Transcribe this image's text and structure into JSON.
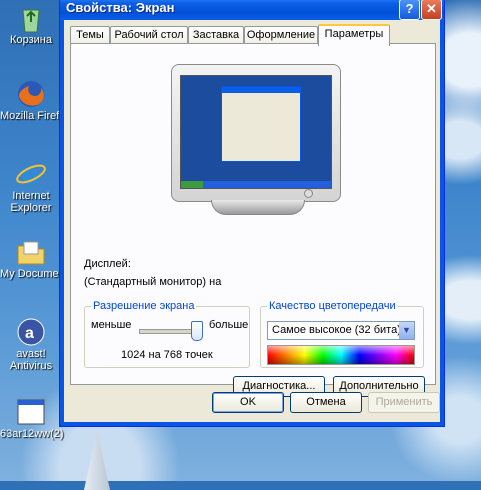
{
  "desktop": {
    "icons": [
      {
        "label": "Корзина"
      },
      {
        "label": "Mozilla Firefo"
      },
      {
        "label": "Internet",
        "label2": "Explorer"
      },
      {
        "label": "My Document"
      },
      {
        "label": "avast!",
        "label2": "Antivirus"
      },
      {
        "label": "63ar12ww(2)"
      }
    ]
  },
  "window": {
    "title": "Свойства: Экран",
    "help_glyph": "?",
    "close_glyph": "✕",
    "tabs": [
      {
        "label": "Темы"
      },
      {
        "label": "Рабочий стол"
      },
      {
        "label": "Заставка"
      },
      {
        "label": "Оформление"
      },
      {
        "label": "Параметры"
      }
    ],
    "active_tab": "Параметры",
    "display_label": "Дисплей:",
    "display_value": "(Стандартный монитор) на",
    "resolution": {
      "legend": "Разрешение экрана",
      "less": "меньше",
      "more": "больше",
      "value": "1024 на 768 точек",
      "slider_position": 1.0
    },
    "color_quality": {
      "legend": "Качество цветопередачи",
      "selected": "Самое высокое (32 бита)"
    },
    "buttons": {
      "diagnostics": "Диагностика...",
      "advanced": "Дополнительно",
      "ok": "OK",
      "cancel": "Отмена",
      "apply": "Применить"
    }
  }
}
